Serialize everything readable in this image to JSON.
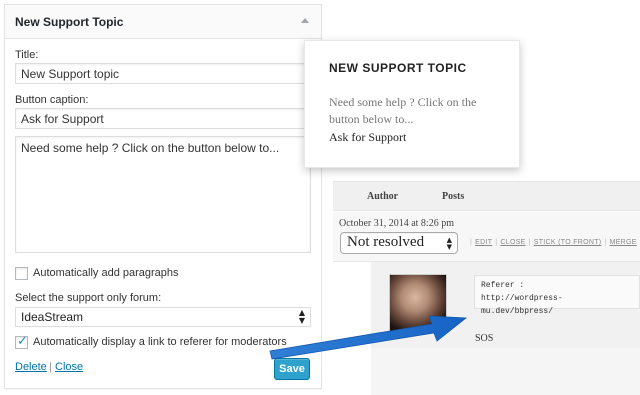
{
  "widget": {
    "title": "New Support Topic",
    "title_label": "Title:",
    "title_value": "New Support topic",
    "caption_label": "Button caption:",
    "caption_value": "Ask for Support",
    "body_text": "Need some help ? Click on the button below to...",
    "auto_paragraphs_label": "Automatically add paragraphs",
    "auto_paragraphs_checked": false,
    "forum_label": "Select the support only forum:",
    "forum_value": "IdeaStream",
    "referer_label": "Automatically display a link to referer for moderators",
    "referer_checked": true,
    "delete_link": "Delete",
    "link_separator": "|",
    "close_link": "Close",
    "save_button": "Save",
    "accent_color": "#2ea2cc"
  },
  "popup": {
    "title": "NEW SUPPORT TOPIC",
    "text": "Need some help ? Click on the button below to...",
    "button": "Ask for Support"
  },
  "forum": {
    "columns": [
      "Author",
      "Posts"
    ],
    "date": "October 31, 2014 at 8:26 pm",
    "status_value": "Not resolved",
    "actions": [
      "EDIT",
      "CLOSE",
      "STICK (TO FRONT)",
      "MERGE"
    ],
    "referer_label": "Referer :",
    "referer_url": "http://wordpress-mu.dev/bbpress/",
    "post_text": "SOS"
  },
  "icons": {
    "collapse": "collapse-arrow-icon",
    "select_arrows": "select-arrows-icon",
    "check": "checkmark-icon",
    "pointer": "blue-arrow"
  }
}
